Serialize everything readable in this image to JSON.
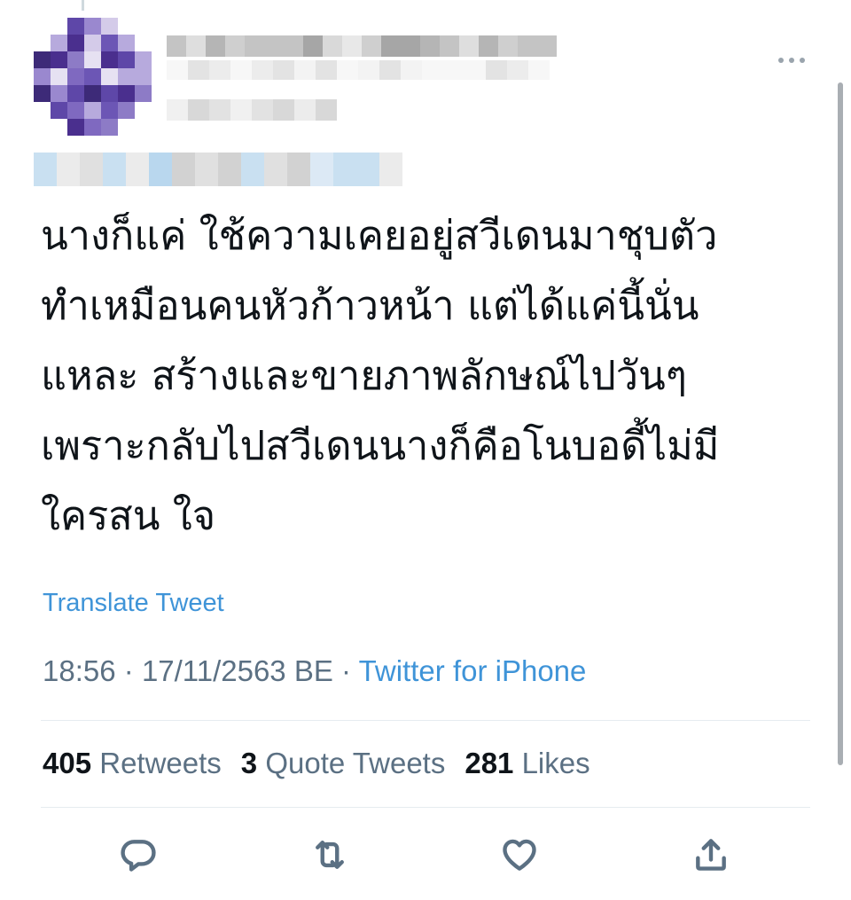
{
  "tweet": {
    "lines": [
      "นางก็แค่ ใช้ความเคยอยู่สวีเดนมาชุบตัว",
      "ทำเหมือนคนหัวก้าวหน้า แต่ได้แค่นี้นั่น",
      "แหละ สร้างและขายภาพลักษณ์ไปวันๆ",
      "เพราะกลับไปสวีเดนนางก็คือโนบอดี้ไม่มี",
      "ใครสน ใจ"
    ],
    "translate_label": "Translate Tweet",
    "time": "18:56",
    "date": "17/11/2563 BE",
    "separator": "·",
    "source": "Twitter for iPhone"
  },
  "stats": {
    "retweets_count": "405",
    "retweets_label": "Retweets",
    "quotes_count": "3",
    "quotes_label": "Quote Tweets",
    "likes_count": "281",
    "likes_label": "Likes"
  },
  "icons": {
    "more": "more-horizontal-icon",
    "reply": "reply-icon",
    "retweet": "retweet-icon",
    "like": "heart-icon",
    "share": "share-icon"
  },
  "colors": {
    "link": "#3f94d8",
    "secondary": "#5b7083",
    "text": "#0f1419",
    "avatar_purple": "#5b3aa0"
  }
}
